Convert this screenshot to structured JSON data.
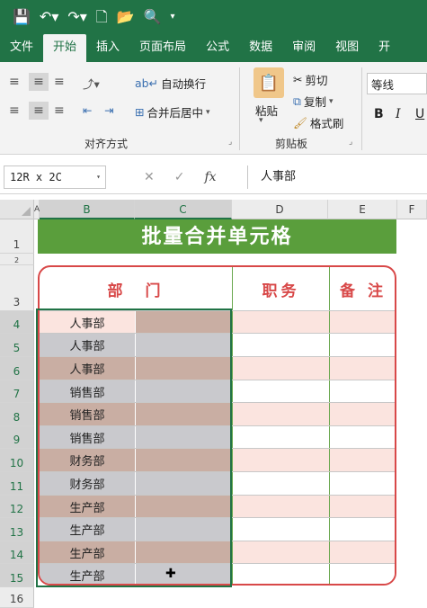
{
  "ribbon_tabs": [
    "文件",
    "开始",
    "插入",
    "页面布局",
    "公式",
    "数据",
    "审阅",
    "视图",
    "开"
  ],
  "ribbon": {
    "align_group": {
      "wrap": "自动换行",
      "merge": "合并后居中",
      "label": "对齐方式"
    },
    "clipboard_group": {
      "paste": "粘贴",
      "cut": "剪切",
      "copy": "复制",
      "format_painter": "格式刷",
      "label": "剪贴板"
    },
    "font_group": {
      "font_name": "等线",
      "bold": "B",
      "italic": "I",
      "underline": "U"
    }
  },
  "formula_bar": {
    "name_box": "12R x 2C",
    "cancel": "✕",
    "enter": "✓",
    "fx": "fx",
    "content": "人事部"
  },
  "grid": {
    "columns": [
      "A",
      "B",
      "C",
      "D",
      "E",
      "F"
    ],
    "rows": [
      "1",
      "2",
      "3",
      "4",
      "5",
      "6",
      "7",
      "8",
      "9",
      "10",
      "11",
      "12",
      "13",
      "14",
      "15",
      "16"
    ],
    "title": "批量合并单元格",
    "headers": {
      "dept": "部　门",
      "position": "职务",
      "remark": "备 注"
    },
    "departments": [
      "人事部",
      "人事部",
      "人事部",
      "销售部",
      "销售部",
      "销售部",
      "财务部",
      "财务部",
      "生产部",
      "生产部",
      "生产部",
      "生产部"
    ]
  },
  "colors": {
    "ribbon_green": "#217346",
    "title_green": "#5a9e3c",
    "table_red": "#d84848",
    "band_brown": "#c9aea3",
    "band_gray": "#c9c9cd",
    "band_pink": "#fbe4df"
  }
}
